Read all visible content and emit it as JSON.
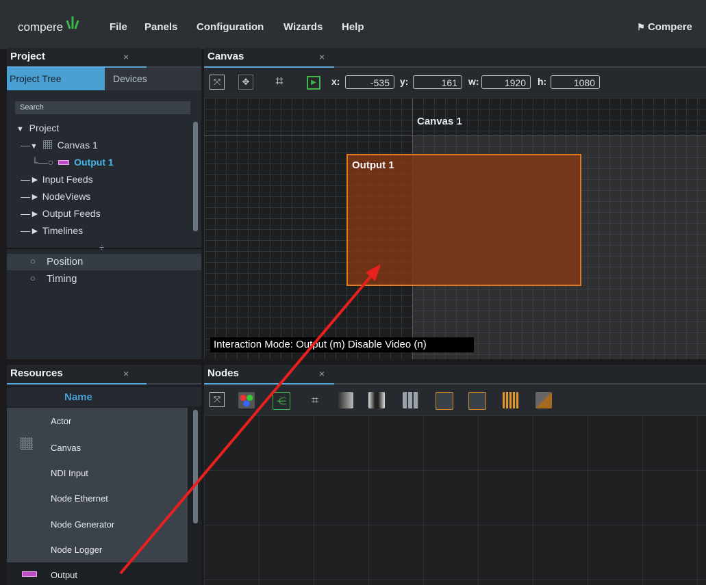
{
  "app": {
    "logo_text": "compere",
    "user_label": "Compere"
  },
  "menu": {
    "file": "File",
    "panels": "Panels",
    "configuration": "Configuration",
    "wizards": "Wizards",
    "help": "Help"
  },
  "project_panel": {
    "title": "Project",
    "close": "×",
    "tabs": {
      "tree": "Project Tree",
      "devices": "Devices"
    },
    "search_placeholder": "Search",
    "tree": {
      "project": "Project",
      "canvas": "Canvas 1",
      "output": "Output 1",
      "input_feeds": "Input Feeds",
      "nodeviews": "NodeViews",
      "output_feeds": "Output Feeds",
      "timelines": "Timelines"
    },
    "props": {
      "position": "Position",
      "timing": "Timing"
    }
  },
  "canvas_panel": {
    "title": "Canvas",
    "close": "×",
    "fields": {
      "x_label": "x:",
      "x": "-535",
      "y_label": "y:",
      "y": "161",
      "w_label": "w:",
      "w": "1920",
      "h_label": "h:",
      "h": "1080"
    },
    "canvas_label": "Canvas 1",
    "output_label": "Output 1",
    "interaction_text": "Interaction Mode: Output (m) Disable Video (n)"
  },
  "resources_panel": {
    "title": "Resources",
    "close": "×",
    "col_name": "Name",
    "items": [
      "Actor",
      "Canvas",
      "NDI Input",
      "Node Ethernet",
      "Node Generator",
      "Node Logger",
      "Output"
    ]
  },
  "nodes_panel": {
    "title": "Nodes",
    "close": "×"
  },
  "colors": {
    "accent": "#4a9fd3",
    "output_border": "#e07a1e",
    "arrow": "#e8201e",
    "tree_selected": "#4ab5e8"
  }
}
